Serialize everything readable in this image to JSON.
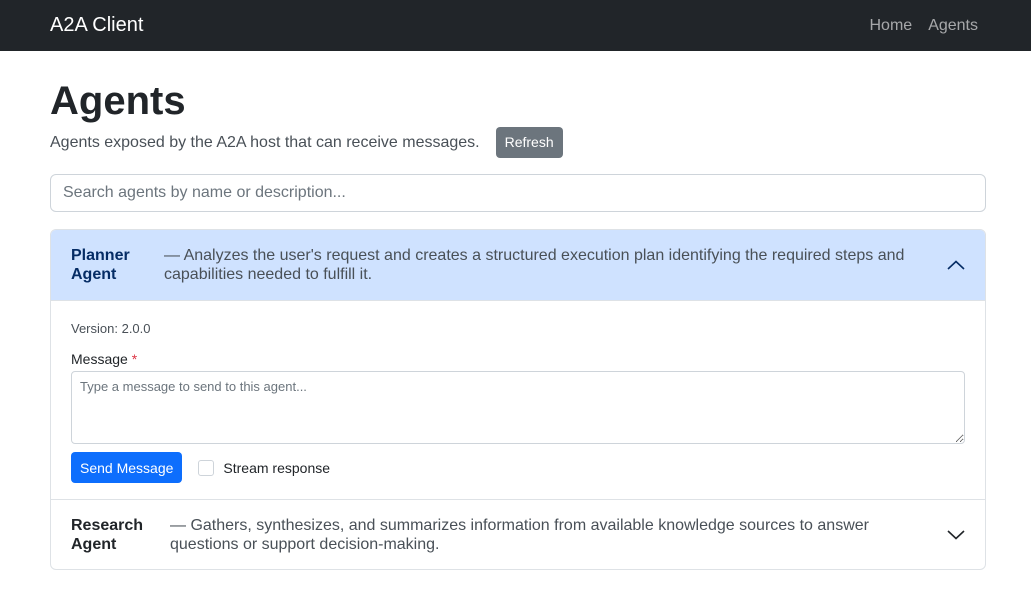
{
  "navbar": {
    "brand": "A2A Client",
    "links": [
      "Home",
      "Agents"
    ]
  },
  "page": {
    "title": "Agents",
    "subtitle": "Agents exposed by the A2A host that can receive messages.",
    "refresh_label": "Refresh"
  },
  "search": {
    "placeholder": "Search agents by name or description..."
  },
  "agents": [
    {
      "name_line1": "Planner",
      "name_line2": "Agent",
      "description": "— Analyzes the user's request and creates a structured execution plan identifying the required steps and capabilities needed to fulfill it.",
      "expanded": true,
      "version_text": "Version: 2.0.0",
      "message_label": "Message",
      "required_mark": "*",
      "message_placeholder": "Type a message to send to this agent...",
      "send_label": "Send Message",
      "stream_label": "Stream response",
      "stream_checked": false
    },
    {
      "name_line1": "Research",
      "name_line2": "Agent",
      "description": "— Gathers, synthesizes, and summarizes information from available knowledge sources to answer questions or support decision-making.",
      "expanded": false
    }
  ],
  "icons": {
    "expanded_chevron": "chevron-up-icon",
    "collapsed_chevron": "chevron-down-icon"
  },
  "colors": {
    "navbar_bg": "#212529",
    "expanded_header_bg": "#cfe2ff",
    "primary": "#0d6efd",
    "secondary": "#6c757d",
    "required": "#dc3545"
  }
}
